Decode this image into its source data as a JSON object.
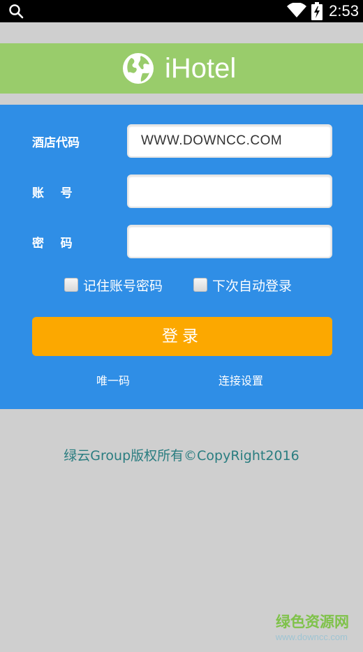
{
  "status_bar": {
    "time": "2:53",
    "icons": [
      "search-icon",
      "wifi-icon",
      "battery-icon"
    ]
  },
  "header": {
    "app_name": "iHotel",
    "logo_icon": "globe-icon",
    "background_color": "#99cc6b"
  },
  "form": {
    "hotel_code_label": "酒店代码",
    "hotel_code_value": "WWW.DOWNCC.COM",
    "account_label": "账    号",
    "account_value": "",
    "password_label": "密    码",
    "password_value": "",
    "remember_label": "记住账号密码",
    "remember_checked": false,
    "auto_login_label": "下次自动登录",
    "auto_login_checked": false,
    "login_button": "登录",
    "unique_code_link": "唯一码",
    "connection_settings_link": "连接设置",
    "panel_color": "#2f8ee6",
    "button_color": "#fca800"
  },
  "footer": {
    "copyright": "绿云Group版权所有©CopyRight2016"
  },
  "watermark": {
    "site_name": "绿色资源网",
    "url": "www.downcc.com"
  }
}
